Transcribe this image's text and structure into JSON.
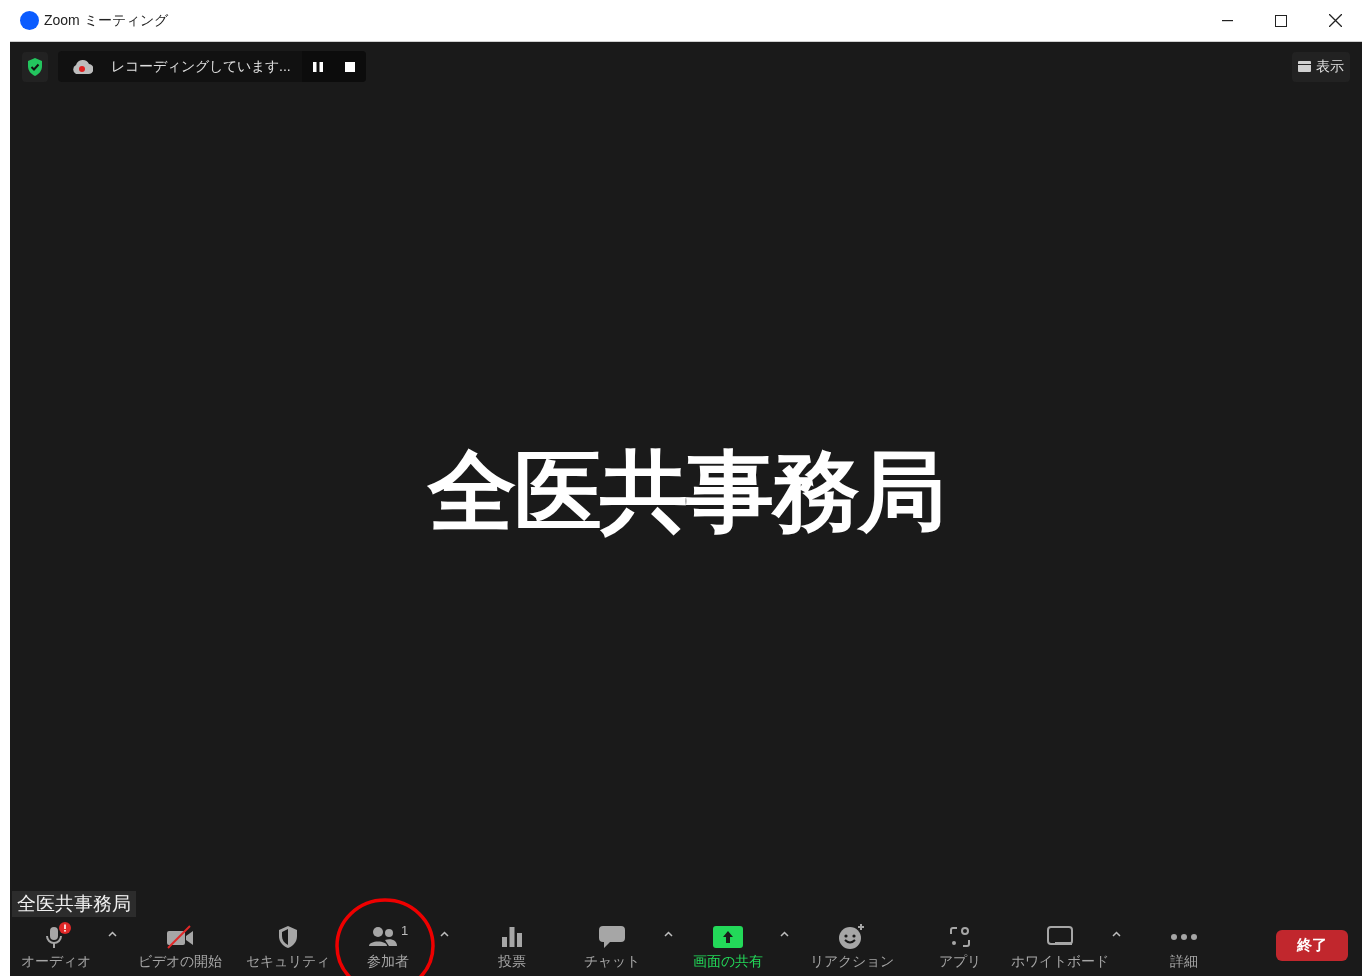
{
  "window": {
    "title": "Zoom ミーティング"
  },
  "recording": {
    "text": "レコーディングしています..."
  },
  "view_button": {
    "label": "表示"
  },
  "main": {
    "display_name": "全医共事務局"
  },
  "name_tag": "全医共事務局",
  "toolbar": [
    {
      "kind": "audio",
      "label": "オーディオ",
      "caret": true,
      "alert": true,
      "off": false,
      "highlighted": false,
      "circled": false
    },
    {
      "kind": "video",
      "label": "ビデオの開始",
      "caret": false,
      "alert": false,
      "off": true,
      "highlighted": false,
      "circled": false
    },
    {
      "kind": "security",
      "label": "セキュリティ",
      "caret": false,
      "alert": false,
      "off": false,
      "highlighted": false,
      "circled": false
    },
    {
      "kind": "participants",
      "label": "参加者",
      "count": "1",
      "caret": true,
      "alert": false,
      "off": false,
      "highlighted": false,
      "circled": true
    },
    {
      "kind": "polls",
      "label": "投票",
      "caret": false,
      "alert": false,
      "off": false,
      "highlighted": false,
      "circled": false
    },
    {
      "kind": "chat",
      "label": "チャット",
      "caret": true,
      "alert": false,
      "off": false,
      "highlighted": false,
      "circled": false
    },
    {
      "kind": "share",
      "label": "画面の共有",
      "caret": true,
      "alert": false,
      "off": false,
      "highlighted": true,
      "circled": false
    },
    {
      "kind": "reactions",
      "label": "リアクション",
      "caret": false,
      "alert": false,
      "off": false,
      "highlighted": false,
      "circled": false
    },
    {
      "kind": "apps",
      "label": "アプリ",
      "caret": false,
      "alert": false,
      "off": false,
      "highlighted": false,
      "circled": false
    },
    {
      "kind": "whiteboard",
      "label": "ホワイトボード",
      "caret": true,
      "alert": false,
      "off": false,
      "highlighted": false,
      "circled": false
    },
    {
      "kind": "more",
      "label": "詳細",
      "caret": false,
      "alert": false,
      "off": false,
      "highlighted": false,
      "circled": false
    }
  ],
  "end_button": {
    "label": "終了"
  }
}
